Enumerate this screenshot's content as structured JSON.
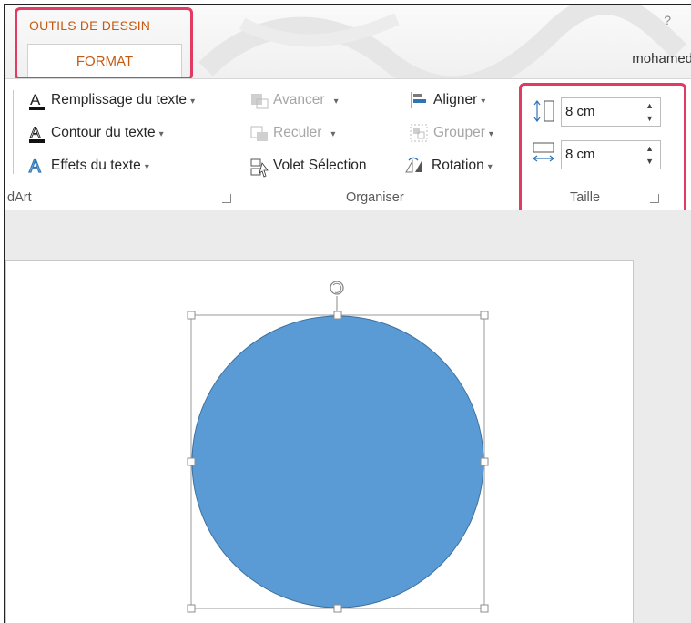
{
  "context_tab": {
    "group_label": "OUTILS DE DESSIN",
    "tab_label": "FORMAT"
  },
  "header": {
    "help": "?",
    "user": "mohamed"
  },
  "wordart": {
    "fill": "Remplissage du texte",
    "outline": "Contour du texte",
    "effects": "Effets du texte",
    "group_label": "dArt"
  },
  "organiser": {
    "forward": "Avancer",
    "backward": "Reculer",
    "selection_pane": "Volet Sélection",
    "align": "Aligner",
    "group": "Grouper",
    "rotate": "Rotation",
    "group_label": "Organiser"
  },
  "taille": {
    "height_value": "8 cm",
    "width_value": "8 cm",
    "group_label": "Taille"
  },
  "colors": {
    "accent": "#c55a11",
    "highlight": "#e23b63",
    "shape_fill": "#5b9bd5",
    "shape_stroke": "#41719c"
  }
}
